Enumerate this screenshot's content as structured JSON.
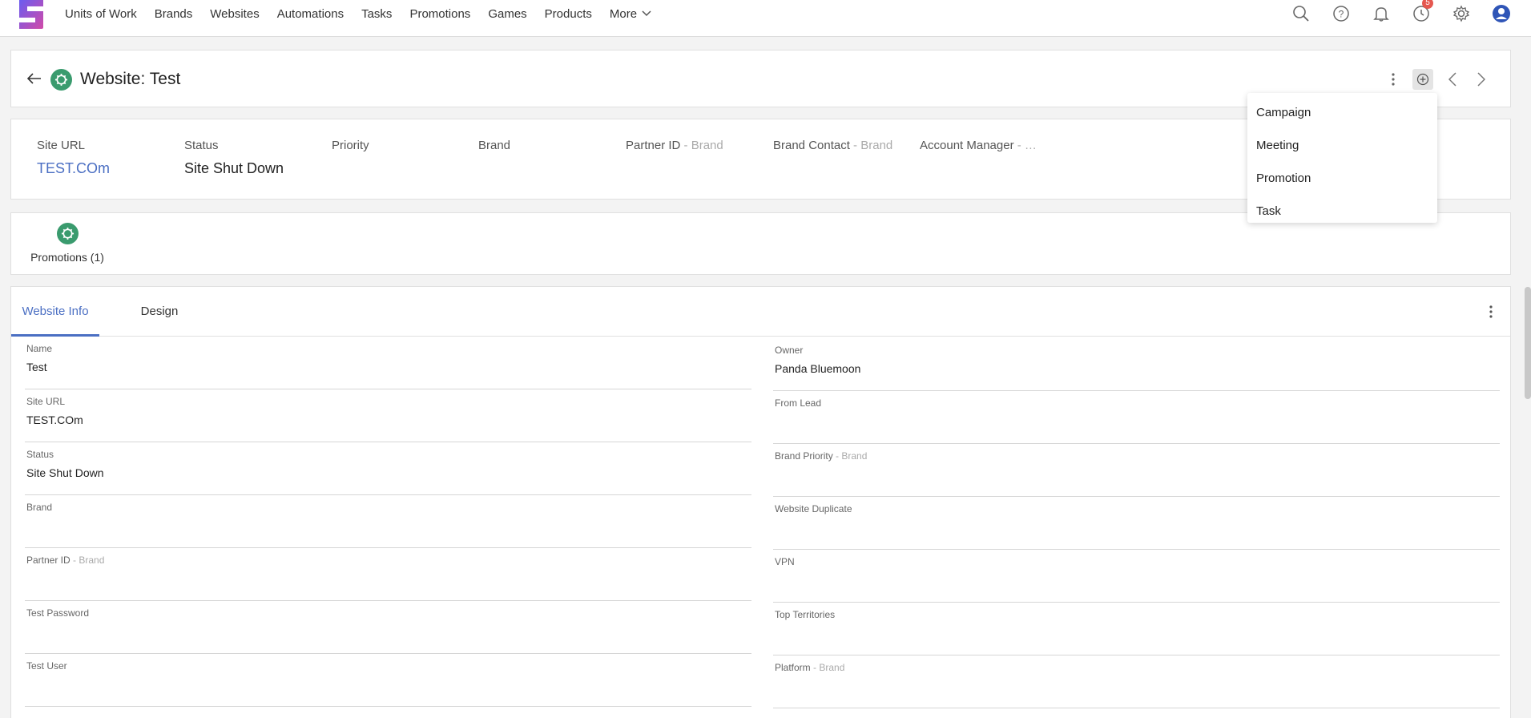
{
  "colors": {
    "accent": "#4b6fc3",
    "record_icon": "#3a9b6e",
    "badge": "#e5574f"
  },
  "nav": {
    "items": [
      "Units of Work",
      "Brands",
      "Websites",
      "Automations",
      "Tasks",
      "Promotions",
      "Games",
      "Products"
    ],
    "more_label": "More"
  },
  "top_icons": {
    "search": "search-icon",
    "help": "help-icon",
    "notifications": "bell-icon",
    "history": "clock-icon",
    "history_badge": "5",
    "settings": "gear-icon",
    "account": "user-icon"
  },
  "header": {
    "title": "Website: Test"
  },
  "summary": {
    "site_url": {
      "label": "Site URL",
      "value": "TEST.COm"
    },
    "status": {
      "label": "Status",
      "value": "Site Shut Down"
    },
    "priority": {
      "label": "Priority",
      "value": ""
    },
    "brand": {
      "label": "Brand",
      "value": ""
    },
    "partner_id": {
      "label": "Partner ID",
      "sub": " - Brand"
    },
    "brand_contact": {
      "label": "Brand Contact",
      "sub": " - Brand"
    },
    "account_manager": {
      "label": "Account Manager",
      "sub": " - …"
    }
  },
  "related": {
    "promotions_label": "Promotions (1)"
  },
  "tabs": [
    "Website Info",
    "Design"
  ],
  "fields_left": [
    {
      "label": "Name",
      "sub": "",
      "value": "Test"
    },
    {
      "label": "Site URL",
      "sub": "",
      "value": "TEST.COm"
    },
    {
      "label": "Status",
      "sub": "",
      "value": "Site Shut Down"
    },
    {
      "label": "Brand",
      "sub": "",
      "value": ""
    },
    {
      "label": "Partner ID",
      "sub": " - Brand",
      "value": ""
    },
    {
      "label": "Test Password",
      "sub": "",
      "value": ""
    },
    {
      "label": "Test User",
      "sub": "",
      "value": ""
    }
  ],
  "fields_right": [
    {
      "label": "Owner",
      "sub": "",
      "value": "Panda Bluemoon"
    },
    {
      "label": "From Lead",
      "sub": "",
      "value": ""
    },
    {
      "label": "Brand Priority",
      "sub": " - Brand",
      "value": ""
    },
    {
      "label": "Website Duplicate",
      "sub": "",
      "value": ""
    },
    {
      "label": "VPN",
      "sub": "",
      "value": ""
    },
    {
      "label": "Top Territories",
      "sub": "",
      "value": ""
    },
    {
      "label": "Platform",
      "sub": " - Brand",
      "value": ""
    }
  ],
  "add_menu": [
    "Campaign",
    "Meeting",
    "Promotion",
    "Task"
  ]
}
